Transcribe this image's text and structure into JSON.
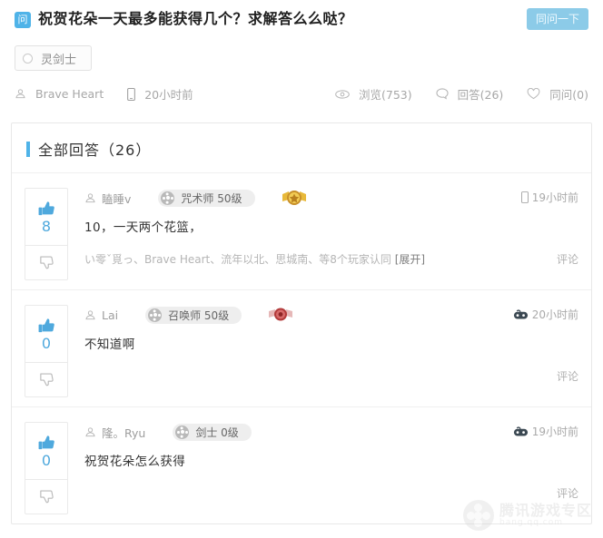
{
  "question": {
    "badge_label": "问",
    "title": "祝贺花朵一天最多能获得几个？求解答么么哒？",
    "ask_button": "同问一下",
    "tag": "灵剑士",
    "author": "Brave Heart",
    "time": "20小时前",
    "views_label": "浏览(753)",
    "answers_label": "回答(26)",
    "follow_label": "同问(0)"
  },
  "answers_section": {
    "title": "全部回答（26）",
    "accent_color": "#4fb3e8"
  },
  "answers": [
    {
      "votes": "8",
      "user": "瞌睡v",
      "class_pill": "咒术师 50级",
      "medal": "gold-medal-icon",
      "time": "19小时前",
      "time_icon": "phone-icon",
      "text": "10，一天两个花篮，",
      "agree": "い零ˇ覓っ、Brave Heart、流年以北、思城南、等8个玩家认同",
      "expand": "[展开]",
      "comment": "评论"
    },
    {
      "votes": "0",
      "user": "Lai",
      "class_pill": "召唤师 50级",
      "medal": "red-medal-icon",
      "time": "20小时前",
      "time_icon": "gamepad-icon",
      "text": "不知道啊",
      "agree": "",
      "expand": "",
      "comment": "评论"
    },
    {
      "votes": "0",
      "user": "隆。Ryu",
      "class_pill": "剑士 0级",
      "medal": "",
      "time": "19小时前",
      "time_icon": "gamepad-icon",
      "text": "祝贺花朵怎么获得",
      "agree": "",
      "expand": "",
      "comment": "评论"
    }
  ],
  "watermark": {
    "line1": "腾讯游戏专区",
    "line2": "bang.qq.com"
  }
}
